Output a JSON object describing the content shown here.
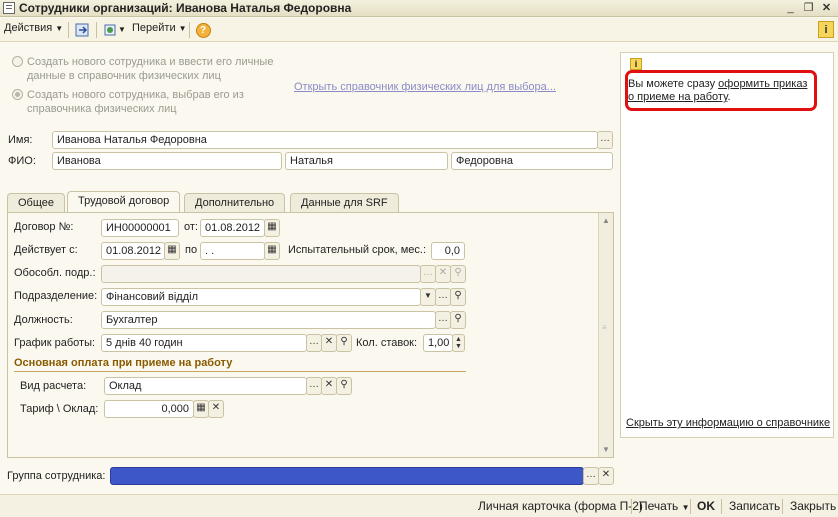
{
  "window": {
    "title": "Сотрудники организаций: Иванова Наталья Федоровна"
  },
  "toolbar": {
    "actions_label": "Действия",
    "goto_label": "Перейти",
    "help_glyph": "?"
  },
  "options": {
    "create_new_label": "Создать нового сотрудника и ввести его личные данные в справочник физических лиц",
    "create_new_line1": "Создать нового сотрудника и ввести его личные",
    "create_new_line2": "данные в справочник физических лиц",
    "select_existing_line1": "Создать нового сотрудника, выбрав его из",
    "select_existing_line2": "справочника физических лиц",
    "open_directory_link": "Открыть справочник физических лиц для выбора..."
  },
  "person": {
    "name_label": "Имя:",
    "name_value": "Иванова Наталья Федоровна",
    "fio_label": "ФИО:",
    "last_name": "Иванова",
    "first_name": "Наталья",
    "middle_name": "Федоровна"
  },
  "tabs": [
    {
      "label": "Общее"
    },
    {
      "label": "Трудовой договор"
    },
    {
      "label": "Дополнительно"
    },
    {
      "label": "Данные для SRF"
    }
  ],
  "contract": {
    "number_label": "Договор №:",
    "number_value": "ИН00000001",
    "from_label": "от:",
    "from_value": "01.08.2012",
    "valid_label": "Действует с:",
    "valid_from": "01.08.2012",
    "to_label": "по",
    "valid_to": " .  .",
    "probation_label": "Испытательный срок, мес.:",
    "probation_value": "0,0",
    "branch_label": "Обособл. подр.:",
    "branch_value": "",
    "department_label": "Подразделение:",
    "department_value": "Фінансовий відділ",
    "position_label": "Должность:",
    "position_value": "Бухгалтер",
    "schedule_label": "График работы:",
    "schedule_value": "5 днів 40 годин",
    "rates_label": "Кол. ставок:",
    "rates_value": "1,00"
  },
  "payment": {
    "section_title": "Основная оплата при приеме на работу",
    "calc_type_label": "Вид расчета:",
    "calc_type_value": "Оклад",
    "tariff_label": "Тариф \\ Оклад:",
    "tariff_value": "0,000"
  },
  "group": {
    "label": "Группа сотрудника:",
    "value": ""
  },
  "info": {
    "text_prefix": "Вы можете сразу ",
    "link_part1": "оформить приказ",
    "link_part2": "о приеме на работу",
    "text_suffix": ".",
    "hide_link": "Скрыть эту информацию о справочнике"
  },
  "status": {
    "card_label": "Личная карточка (форма П-2)",
    "print_label": "Печать",
    "ok_label": "OK",
    "save_label": "Записать",
    "close_label": "Закрыть"
  },
  "colors": {
    "accent_red": "#e01010",
    "link_blue": "#3030a8",
    "group_blue": "#3d56c8",
    "section_brown": "#8a5a00"
  },
  "icons": [
    "window-icon",
    "minimize-icon",
    "restore-icon",
    "close-icon",
    "move-icon",
    "navigate-icon",
    "help-icon",
    "info-icon",
    "calendar-icon",
    "search-icon",
    "clear-icon",
    "ellipsis-icon",
    "dropdown-icon",
    "spinner-icon"
  ]
}
